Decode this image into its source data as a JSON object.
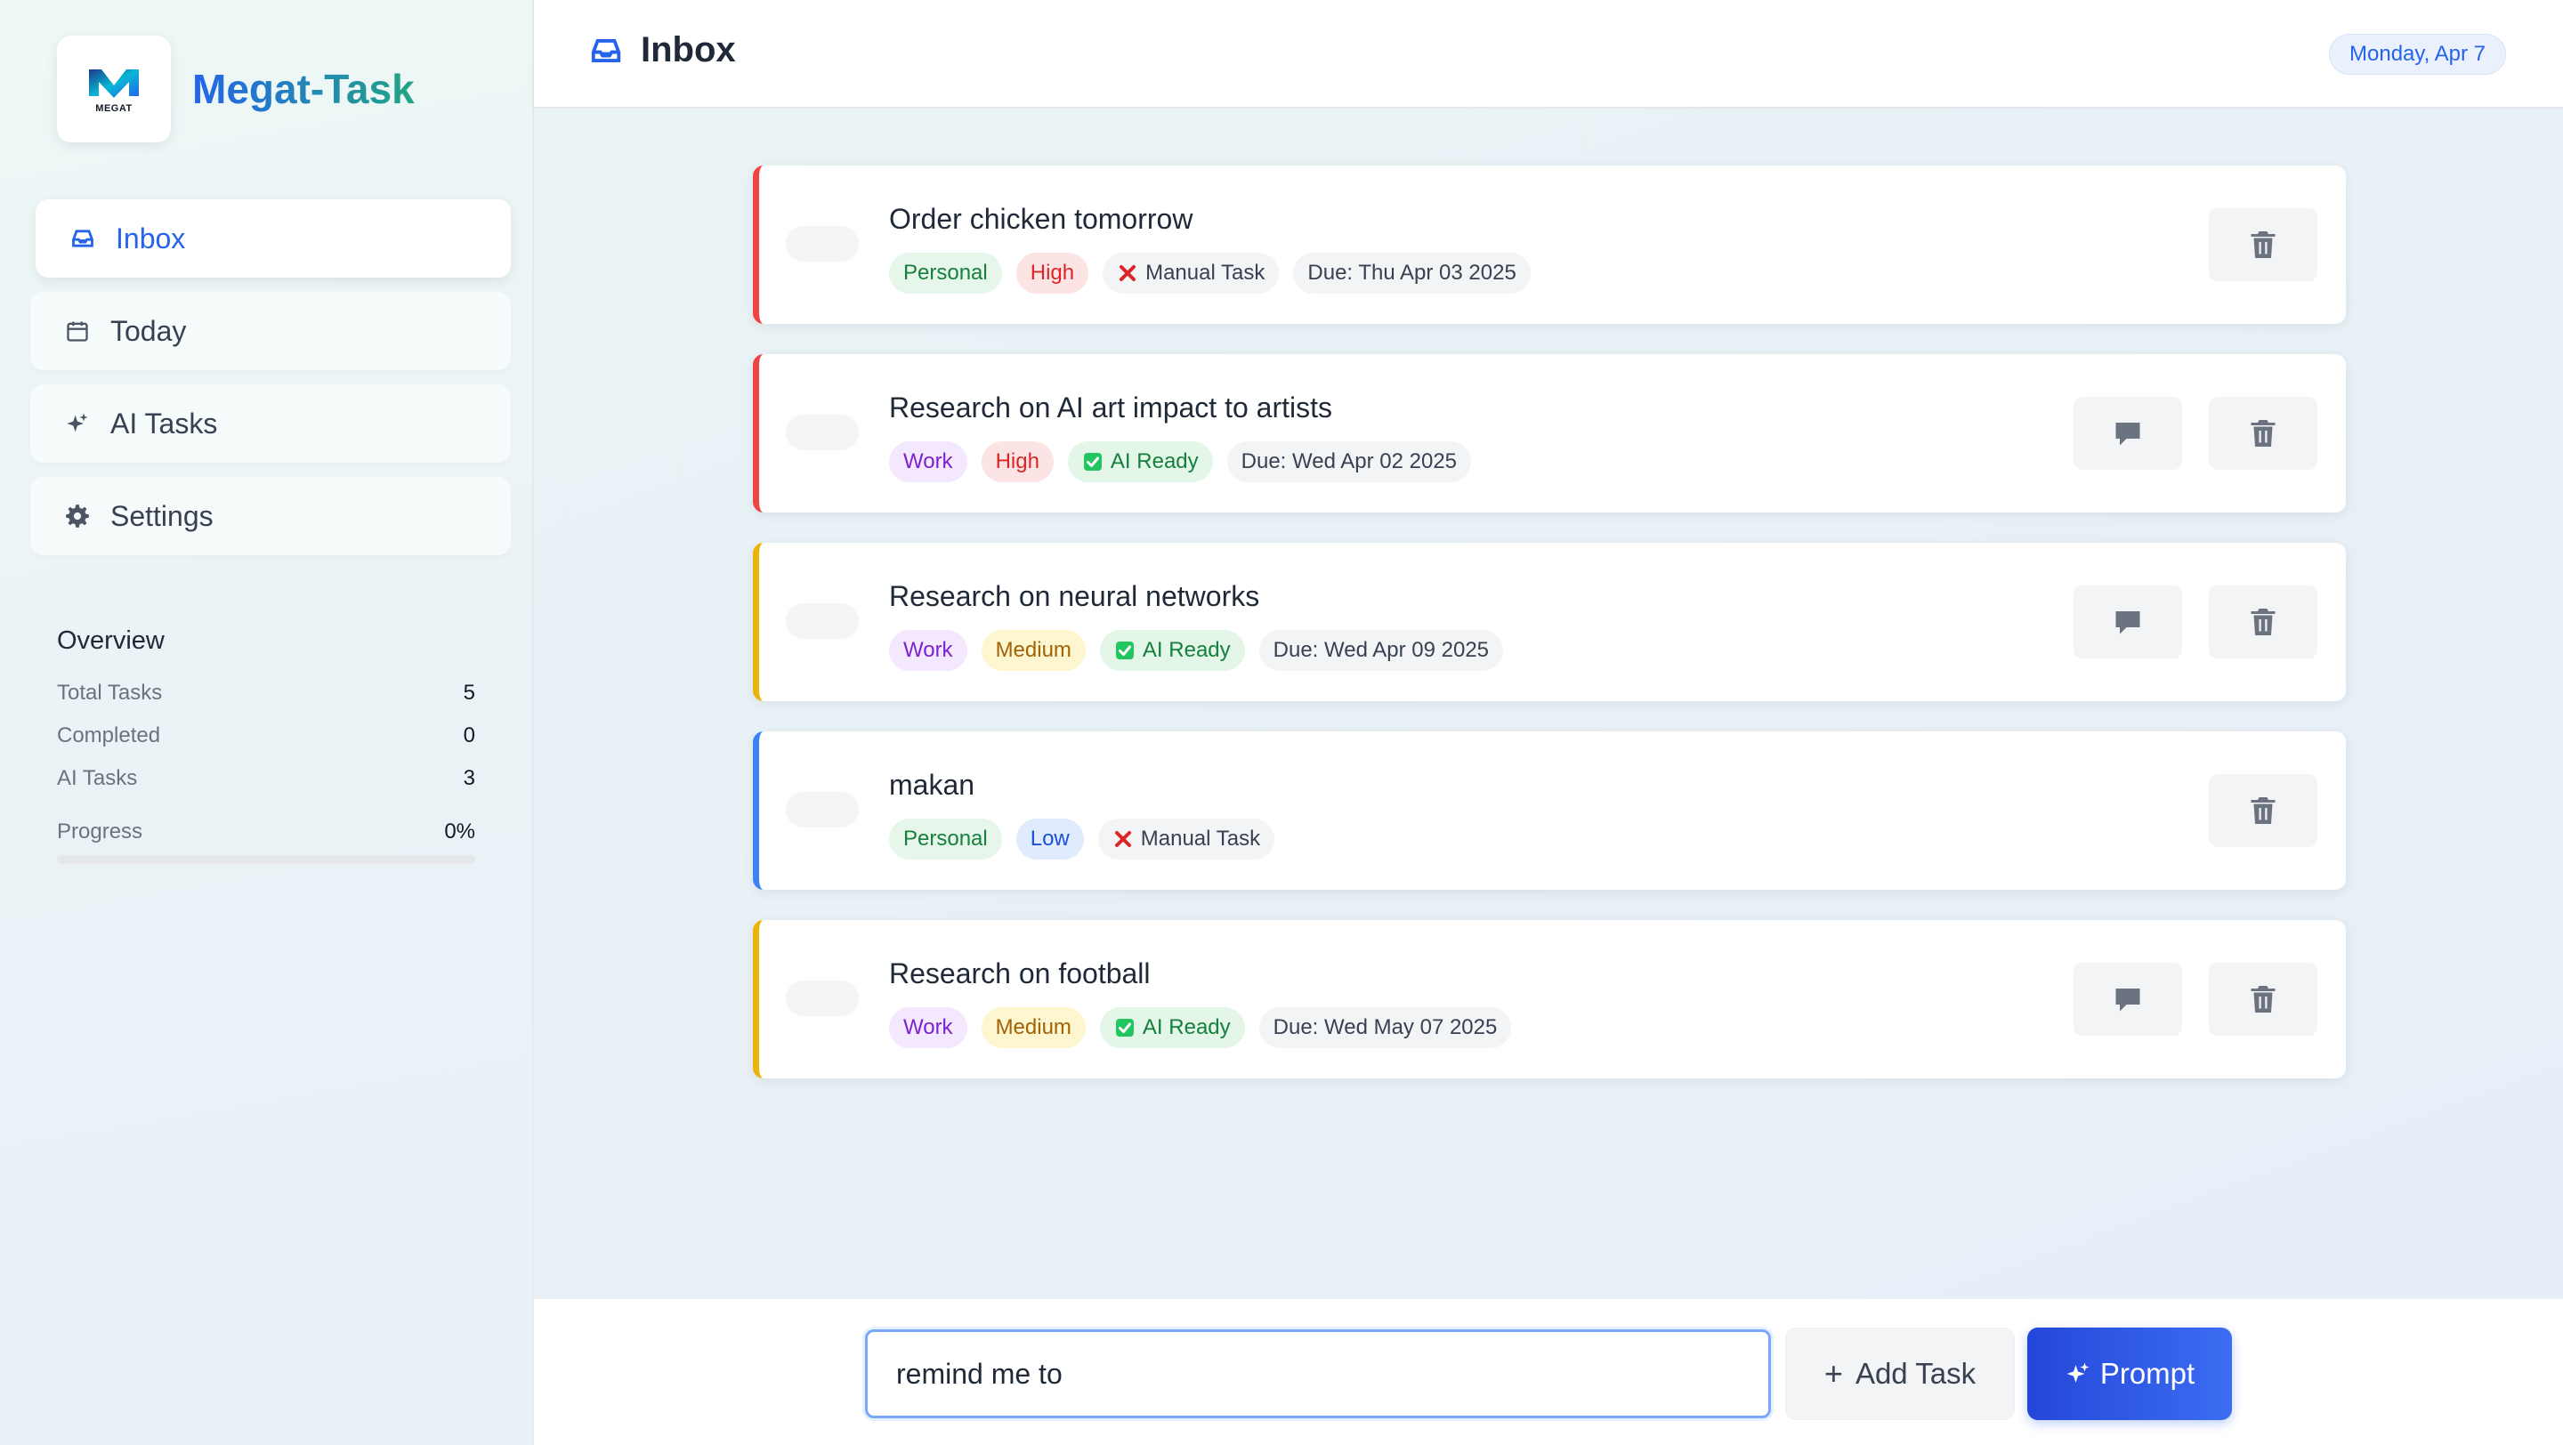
{
  "brand": {
    "name": "Megat-Task",
    "logo_text": "MEGAT"
  },
  "colors": {
    "accent": "#2563eb",
    "priority_high": "#ef4444",
    "priority_medium": "#eab308",
    "priority_low": "#3b82f6"
  },
  "nav": [
    {
      "label": "Inbox",
      "icon": "inbox-icon",
      "active": true
    },
    {
      "label": "Today",
      "icon": "calendar-icon",
      "active": false
    },
    {
      "label": "AI Tasks",
      "icon": "sparkles-icon",
      "active": false
    },
    {
      "label": "Settings",
      "icon": "gear-icon",
      "active": false
    }
  ],
  "overview": {
    "title": "Overview",
    "stats": [
      {
        "label": "Total Tasks",
        "value": "5"
      },
      {
        "label": "Completed",
        "value": "0"
      },
      {
        "label": "AI Tasks",
        "value": "3"
      }
    ],
    "progress_label": "Progress",
    "progress_value": "0%",
    "progress_fraction": 0
  },
  "header": {
    "title": "Inbox",
    "icon": "inbox-icon",
    "date": "Monday, Apr 7"
  },
  "tasks": [
    {
      "title": "Order chicken tomorrow",
      "priority": "high",
      "tags": [
        {
          "type": "personal",
          "label": "Personal"
        },
        {
          "type": "high",
          "label": "High"
        },
        {
          "type": "manual",
          "label": "Manual Task",
          "icon": "x-mark-icon"
        },
        {
          "type": "due",
          "label": "Due: Thu Apr 03 2025"
        }
      ],
      "has_chat": false
    },
    {
      "title": "Research on AI art impact to artists",
      "priority": "high",
      "tags": [
        {
          "type": "work",
          "label": "Work"
        },
        {
          "type": "high",
          "label": "High"
        },
        {
          "type": "ai",
          "label": "AI Ready",
          "icon": "check-box-icon"
        },
        {
          "type": "due",
          "label": "Due: Wed Apr 02 2025"
        }
      ],
      "has_chat": true
    },
    {
      "title": "Research on neural networks",
      "priority": "medium",
      "tags": [
        {
          "type": "work",
          "label": "Work"
        },
        {
          "type": "medium",
          "label": "Medium"
        },
        {
          "type": "ai",
          "label": "AI Ready",
          "icon": "check-box-icon"
        },
        {
          "type": "due",
          "label": "Due: Wed Apr 09 2025"
        }
      ],
      "has_chat": true
    },
    {
      "title": "makan",
      "priority": "low",
      "tags": [
        {
          "type": "personal",
          "label": "Personal"
        },
        {
          "type": "low",
          "label": "Low"
        },
        {
          "type": "manual",
          "label": "Manual Task",
          "icon": "x-mark-icon"
        }
      ],
      "has_chat": false
    },
    {
      "title": "Research on football",
      "priority": "medium",
      "tags": [
        {
          "type": "work",
          "label": "Work"
        },
        {
          "type": "medium",
          "label": "Medium"
        },
        {
          "type": "ai",
          "label": "AI Ready",
          "icon": "check-box-icon"
        },
        {
          "type": "due",
          "label": "Due: Wed May 07 2025"
        }
      ],
      "has_chat": true
    }
  ],
  "composer": {
    "input_value": "remind me to",
    "add_label": "Add Task",
    "prompt_label": "Prompt"
  }
}
